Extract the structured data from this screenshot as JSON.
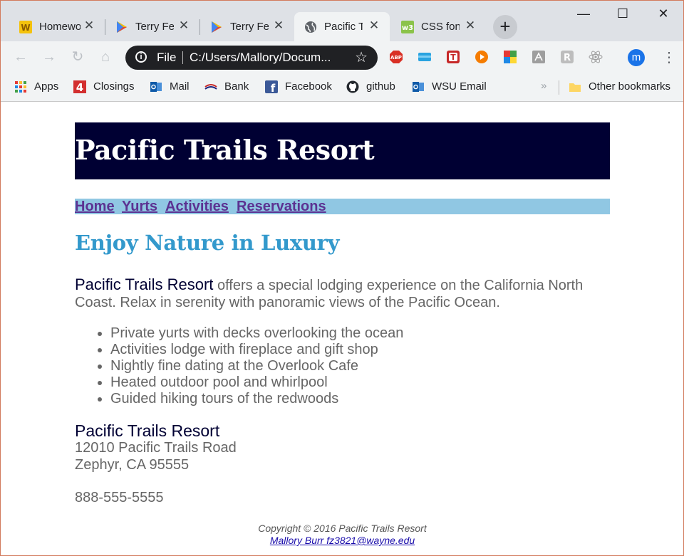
{
  "browser": {
    "tabs": [
      {
        "title": "Homewo",
        "icon": "w-logo-icon"
      },
      {
        "title": "Terry Fel",
        "icon": "play-store-icon"
      },
      {
        "title": "Terry Fel",
        "icon": "play-store-icon"
      },
      {
        "title": "Pacific T",
        "icon": "globe-icon",
        "active": true
      },
      {
        "title": "CSS font",
        "icon": "w3-icon"
      }
    ],
    "new_tab": "+",
    "window": {
      "minimize": "—",
      "maximize": "☐",
      "close": "✕"
    },
    "address": {
      "scheme_label": "File",
      "url": "C:/Users/Mallory/Docum..."
    },
    "profile_initial": "m",
    "bookmarks": [
      {
        "label": "Apps",
        "icon": "apps-grid-icon"
      },
      {
        "label": "Closings",
        "icon": "channel4-icon"
      },
      {
        "label": "Mail",
        "icon": "outlook-icon"
      },
      {
        "label": "Bank",
        "icon": "bank-icon"
      },
      {
        "label": "Facebook",
        "icon": "facebook-icon"
      },
      {
        "label": "github",
        "icon": "github-icon"
      },
      {
        "label": "WSU Email",
        "icon": "outlook-icon"
      }
    ],
    "bookmarks_more": "»",
    "other_bookmarks": "Other bookmarks"
  },
  "page": {
    "header_title": "Pacific Trails Resort",
    "nav": [
      "Home",
      "Yurts",
      "Activities",
      "Reservations"
    ],
    "headline": "Enjoy Nature in Luxury",
    "intro_brand": "Pacific Trails Resort",
    "intro_text": " offers a special lodging experience on the California North Coast. Relax in serenity with panoramic views of the Pacific Ocean.",
    "features": [
      "Private yurts with decks overlooking the ocean",
      "Activities lodge with fireplace and gift shop",
      "Nightly fine dating at the Overlook Cafe",
      "Heated outdoor pool and whirlpool",
      "Guided hiking tours of the redwoods"
    ],
    "contact_name": "Pacific Trails Resort",
    "address_line1": "12010 Pacific Trails Road",
    "address_line2": "Zephyr, CA 95555",
    "phone": "888-555-5555",
    "copyright": "Copyright © 2016 Pacific Trails Resort",
    "email_link": "Mallory Burr fz3821@wayne.edu"
  }
}
